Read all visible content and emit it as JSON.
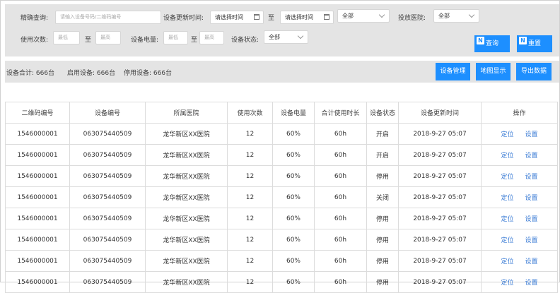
{
  "filter": {
    "search_label": "精确查询:",
    "search_placeholder": "请输入设备号码/二维码编号",
    "update_time_label": "设备更新时间:",
    "date_start": "请选择时间",
    "to1": "至",
    "date_end": "请选择时间",
    "status_select": "全部",
    "hospital_label": "投放医院:",
    "hospital_select": "全部",
    "usage_label": "使用次数:",
    "usage_min_placeholder": "最低",
    "to2": "至",
    "usage_max_placeholder": "最高",
    "battery_label": "设备电量:",
    "battery_min_placeholder": "最低",
    "to3": "至",
    "battery_max_placeholder": "最高",
    "device_status_label": "设备状态:",
    "device_status_select": "全部",
    "query_button": "查询",
    "reset_button": "重置",
    "button_icon_letter": "N"
  },
  "summary": {
    "total": "设备合计: 666台",
    "enabled": "启用设备: 666台",
    "disabled": "停用设备: 666台",
    "manage_button": "设备管理",
    "map_button": "地图显示",
    "export_button": "导出数据"
  },
  "table": {
    "headers": [
      "二维码编号",
      "设备编号",
      "所属医院",
      "使用次数",
      "设备电量",
      "合计使用时长",
      "设备状态",
      "设备更新时间",
      "操作"
    ],
    "rows": [
      {
        "qr": "1546000001",
        "device": "063075440509",
        "hospital": "龙华新区XX医院",
        "uses": "12",
        "battery": "60%",
        "duration": "60h",
        "status": "开启",
        "updated": "2018-9-27 05:07",
        "op1": "定位",
        "op2": "设置"
      },
      {
        "qr": "1546000001",
        "device": "063075440509",
        "hospital": "龙华新区XX医院",
        "uses": "12",
        "battery": "60%",
        "duration": "60h",
        "status": "开启",
        "updated": "2018-9-27 05:07",
        "op1": "定位",
        "op2": "设置"
      },
      {
        "qr": "1546000001",
        "device": "063075440509",
        "hospital": "龙华新区XX医院",
        "uses": "12",
        "battery": "60%",
        "duration": "60h",
        "status": "停用",
        "updated": "2018-9-27 05:07",
        "op1": "定位",
        "op2": "设置"
      },
      {
        "qr": "1546000001",
        "device": "063075440509",
        "hospital": "龙华新区XX医院",
        "uses": "12",
        "battery": "60%",
        "duration": "60h",
        "status": "关闭",
        "updated": "2018-9-27 05:07",
        "op1": "定位",
        "op2": "设置"
      },
      {
        "qr": "1546000001",
        "device": "063075440509",
        "hospital": "龙华新区XX医院",
        "uses": "12",
        "battery": "60%",
        "duration": "60h",
        "status": "停用",
        "updated": "2018-9-27 05:07",
        "op1": "定位",
        "op2": "设置"
      },
      {
        "qr": "1546000001",
        "device": "063075440509",
        "hospital": "龙华新区XX医院",
        "uses": "12",
        "battery": "60%",
        "duration": "60h",
        "status": "停用",
        "updated": "2018-9-27 05:07",
        "op1": "定位",
        "op2": "设置"
      },
      {
        "qr": "1546000001",
        "device": "063075440509",
        "hospital": "龙华新区XX医院",
        "uses": "12",
        "battery": "60%",
        "duration": "60h",
        "status": "停用",
        "updated": "2018-9-27 05:07",
        "op1": "定位",
        "op2": "设置"
      },
      {
        "qr": "1546000001",
        "device": "063075440509",
        "hospital": "龙华新区XX医院",
        "uses": "12",
        "battery": "60%",
        "duration": "60h",
        "status": "停用",
        "updated": "2018-9-27 05:07",
        "op1": "定位",
        "op2": "设置"
      }
    ]
  },
  "colors": {
    "accent": "#1d8fff",
    "panel": "#e4e4e4",
    "link": "#3a7bd5"
  }
}
